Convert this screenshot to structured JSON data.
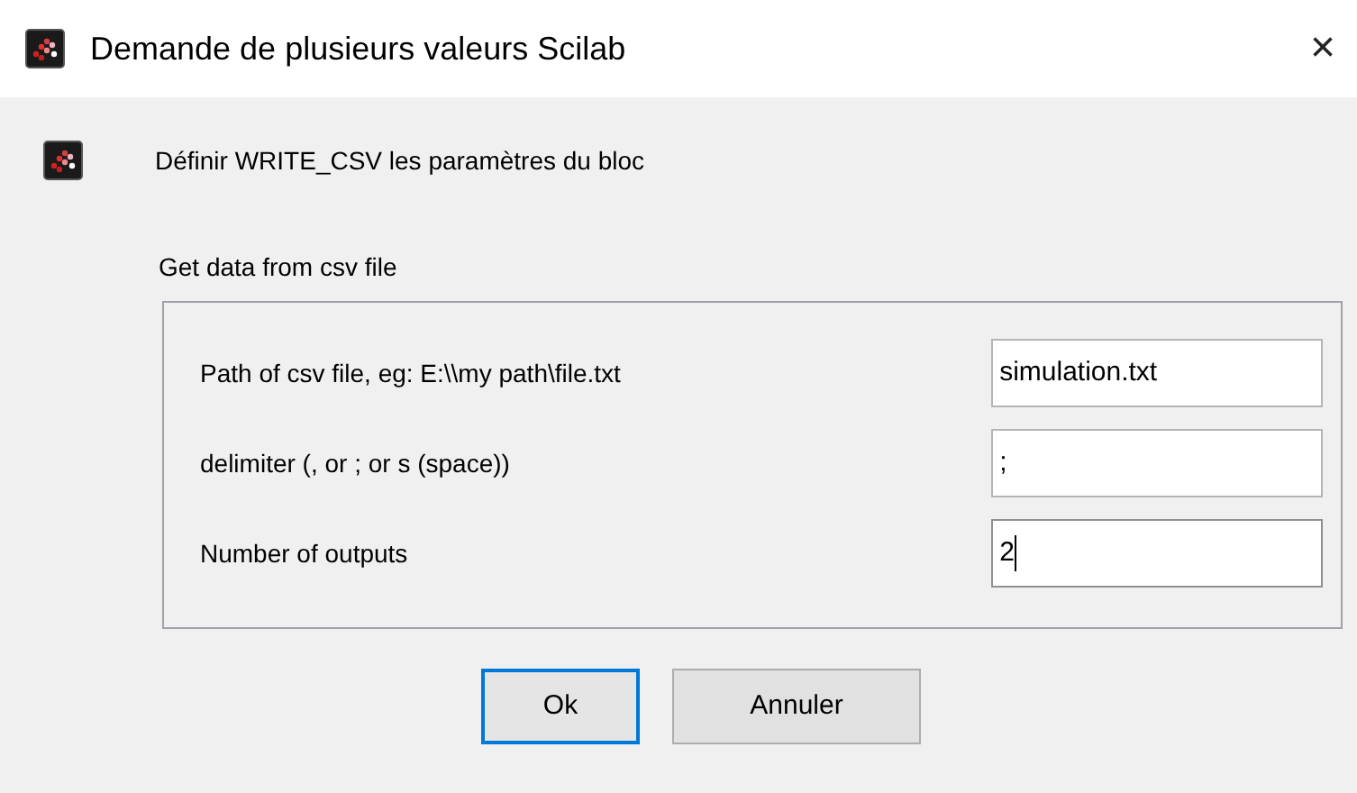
{
  "window": {
    "title": "Demande de plusieurs valeurs Scilab",
    "close": "×"
  },
  "header": "Définir WRITE_CSV les paramètres du bloc",
  "group": {
    "title": "Get data from csv file",
    "fields": [
      {
        "label": "Path of csv file, eg:  E:\\\\my path\\file.txt",
        "value": "simulation.txt",
        "focused": false
      },
      {
        "label": "delimiter (, or ; or s (space))",
        "value": ";",
        "focused": false
      },
      {
        "label": "Number of outputs",
        "value": "2",
        "focused": true
      }
    ]
  },
  "buttons": [
    {
      "label": "Ok",
      "default": true
    },
    {
      "label": "Annuler",
      "default": false
    }
  ]
}
